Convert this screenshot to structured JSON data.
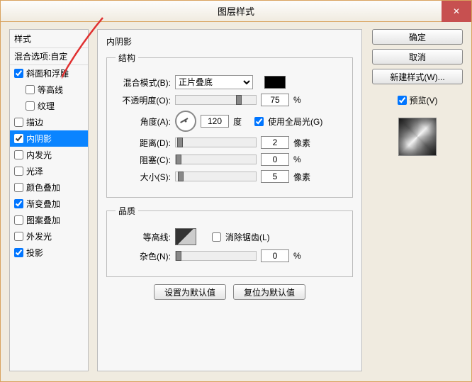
{
  "window": {
    "title": "图层样式"
  },
  "close": "✕",
  "left": {
    "header": "样式",
    "sub": "混合选项:自定",
    "items": [
      {
        "label": "斜面和浮雕",
        "checked": true,
        "indent": false
      },
      {
        "label": "等高线",
        "checked": false,
        "indent": true
      },
      {
        "label": "纹理",
        "checked": false,
        "indent": true
      },
      {
        "label": "描边",
        "checked": false,
        "indent": false
      },
      {
        "label": "内阴影",
        "checked": true,
        "indent": false,
        "selected": true
      },
      {
        "label": "内发光",
        "checked": false,
        "indent": false
      },
      {
        "label": "光泽",
        "checked": false,
        "indent": false
      },
      {
        "label": "颜色叠加",
        "checked": false,
        "indent": false
      },
      {
        "label": "渐变叠加",
        "checked": true,
        "indent": false
      },
      {
        "label": "图案叠加",
        "checked": false,
        "indent": false
      },
      {
        "label": "外发光",
        "checked": false,
        "indent": false
      },
      {
        "label": "投影",
        "checked": true,
        "indent": false
      }
    ]
  },
  "center": {
    "title": "内阴影",
    "structure": {
      "legend": "结构",
      "blend_label": "混合模式(B):",
      "blend_value": "正片叠底",
      "opacity_label": "不透明度(O):",
      "opacity_value": "75",
      "opacity_unit": "%",
      "angle_label": "角度(A):",
      "angle_value": "120",
      "angle_unit": "度",
      "global_light": "使用全局光(G)",
      "distance_label": "距离(D):",
      "distance_value": "2",
      "distance_unit": "像素",
      "choke_label": "阻塞(C):",
      "choke_value": "0",
      "choke_unit": "%",
      "size_label": "大小(S):",
      "size_value": "5",
      "size_unit": "像素"
    },
    "quality": {
      "legend": "品质",
      "contour_label": "等高线:",
      "antialias": "消除锯齿(L)",
      "noise_label": "杂色(N):",
      "noise_value": "0",
      "noise_unit": "%"
    },
    "defaults": {
      "set": "设置为默认值",
      "reset": "复位为默认值"
    }
  },
  "right": {
    "ok": "确定",
    "cancel": "取消",
    "new_style": "新建样式(W)...",
    "preview": "预览(V)"
  }
}
